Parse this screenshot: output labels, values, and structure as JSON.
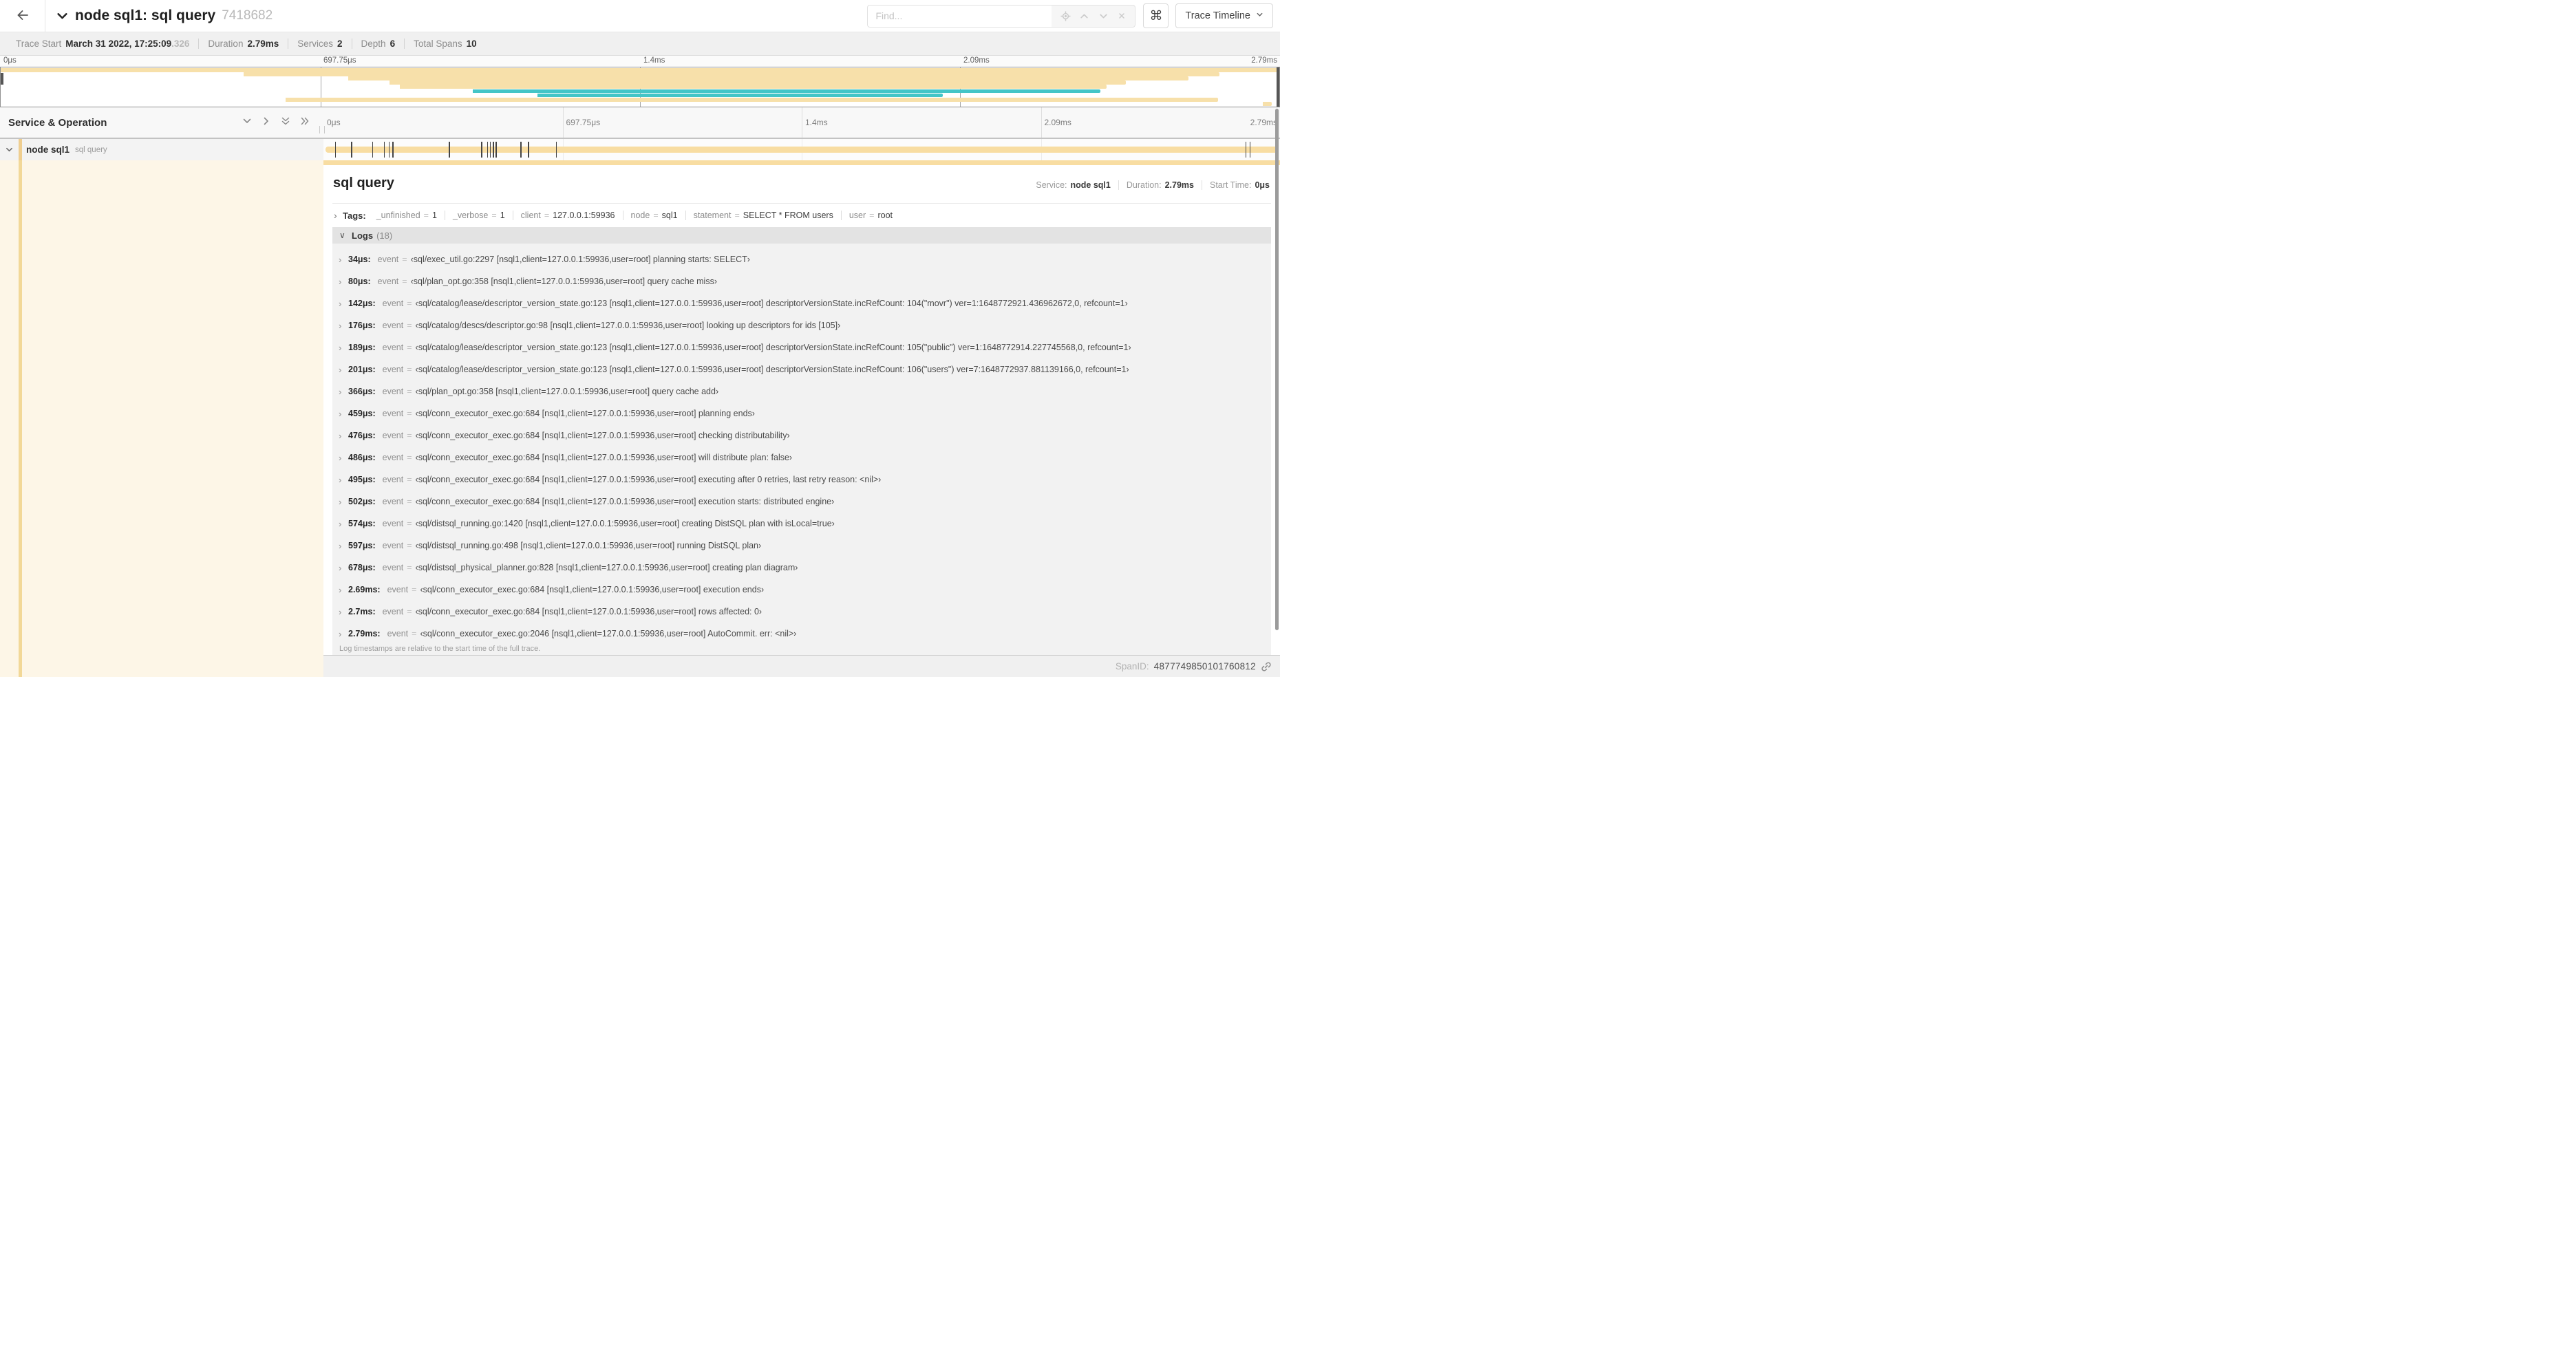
{
  "header": {
    "title": "node sql1: sql query",
    "trace_id": "7418682",
    "find_placeholder": "Find...",
    "view_label": "Trace Timeline"
  },
  "stats": [
    {
      "label": "Trace Start",
      "value": "March 31 2022, 17:25:09",
      "suffix": ".326"
    },
    {
      "label": "Duration",
      "value": "2.79ms"
    },
    {
      "label": "Services",
      "value": "2"
    },
    {
      "label": "Depth",
      "value": "6"
    },
    {
      "label": "Total Spans",
      "value": "10"
    }
  ],
  "ruler_labels": [
    "0μs",
    "697.75μs",
    "1.4ms",
    "2.09ms",
    "2.79ms"
  ],
  "minimap": {
    "colors": {
      "tan": "#f7e0aa",
      "teal": "#44c5c7"
    },
    "rows": [
      {
        "s": 0,
        "e": 100,
        "c": "tan"
      },
      {
        "s": 19,
        "e": 95.3,
        "c": "tan"
      },
      {
        "s": 27.2,
        "e": 92.9,
        "c": "tan"
      },
      {
        "s": 30.4,
        "e": 88,
        "c": "tan"
      },
      {
        "s": 31.2,
        "e": 86.5,
        "c": "tan"
      },
      {
        "s": 36.9,
        "e": 86,
        "c": "teal"
      },
      {
        "s": 42,
        "e": 73.7,
        "c": "teal"
      },
      {
        "s": 22.3,
        "e": 95.2,
        "c": "tan"
      },
      {
        "s": 98.7,
        "e": 99.4,
        "c": "tan"
      }
    ]
  },
  "left_header": "Service & Operation",
  "span_row": {
    "service": "node sql1",
    "operation": "sql query"
  },
  "detail": {
    "title": "sql query",
    "service_label": "Service:",
    "service": "node sql1",
    "duration_label": "Duration:",
    "duration": "2.79ms",
    "start_label": "Start Time:",
    "start": "0μs",
    "tags_label": "Tags:",
    "tags": [
      {
        "k": "_unfinished",
        "v": "1"
      },
      {
        "k": "_verbose",
        "v": "1"
      },
      {
        "k": "client",
        "v": "127.0.0.1:59936"
      },
      {
        "k": "node",
        "v": "sql1"
      },
      {
        "k": "statement",
        "v": "SELECT * FROM users"
      },
      {
        "k": "user",
        "v": "root"
      }
    ],
    "logs_label": "Logs",
    "logs_count": "(18)",
    "logs": [
      {
        "t": "34μs:",
        "k": "event",
        "pct": 1.2,
        "v": "‹sql/exec_util.go:2297 [nsql1,client=127.0.0.1:59936,user=root] planning starts: SELECT›"
      },
      {
        "t": "80μs:",
        "k": "event",
        "pct": 2.9,
        "v": "‹sql/plan_opt.go:358 [nsql1,client=127.0.0.1:59936,user=root] query cache miss›"
      },
      {
        "t": "142μs:",
        "k": "event",
        "pct": 5.1,
        "v": "‹sql/catalog/lease/descriptor_version_state.go:123 [nsql1,client=127.0.0.1:59936,user=root] descriptorVersionState.incRefCount: 104(\"movr\") ver=1:1648772921.436962672,0, refcount=1›"
      },
      {
        "t": "176μs:",
        "k": "event",
        "pct": 6.3,
        "v": "‹sql/catalog/descs/descriptor.go:98 [nsql1,client=127.0.0.1:59936,user=root] looking up descriptors for ids [105]›"
      },
      {
        "t": "189μs:",
        "k": "event",
        "pct": 6.8,
        "v": "‹sql/catalog/lease/descriptor_version_state.go:123 [nsql1,client=127.0.0.1:59936,user=root] descriptorVersionState.incRefCount: 105(\"public\") ver=1:1648772914.227745568,0, refcount=1›"
      },
      {
        "t": "201μs:",
        "k": "event",
        "pct": 7.2,
        "v": "‹sql/catalog/lease/descriptor_version_state.go:123 [nsql1,client=127.0.0.1:59936,user=root] descriptorVersionState.incRefCount: 106(\"users\") ver=7:1648772937.881139166,0, refcount=1›"
      },
      {
        "t": "366μs:",
        "k": "event",
        "pct": 13.1,
        "v": "‹sql/plan_opt.go:358 [nsql1,client=127.0.0.1:59936,user=root] query cache add›"
      },
      {
        "t": "459μs:",
        "k": "event",
        "pct": 16.5,
        "v": "‹sql/conn_executor_exec.go:684 [nsql1,client=127.0.0.1:59936,user=root] planning ends›"
      },
      {
        "t": "476μs:",
        "k": "event",
        "pct": 17.1,
        "v": "‹sql/conn_executor_exec.go:684 [nsql1,client=127.0.0.1:59936,user=root] checking distributability›"
      },
      {
        "t": "486μs:",
        "k": "event",
        "pct": 17.4,
        "v": "‹sql/conn_executor_exec.go:684 [nsql1,client=127.0.0.1:59936,user=root] will distribute plan: false›"
      },
      {
        "t": "495μs:",
        "k": "event",
        "pct": 17.7,
        "v": "‹sql/conn_executor_exec.go:684 [nsql1,client=127.0.0.1:59936,user=root] executing after 0 retries, last retry reason: <nil>›"
      },
      {
        "t": "502μs:",
        "k": "event",
        "pct": 18.0,
        "v": "‹sql/conn_executor_exec.go:684 [nsql1,client=127.0.0.1:59936,user=root] execution starts: distributed engine›"
      },
      {
        "t": "574μs:",
        "k": "event",
        "pct": 20.6,
        "v": "‹sql/distsql_running.go:1420 [nsql1,client=127.0.0.1:59936,user=root] creating DistSQL plan with isLocal=true›"
      },
      {
        "t": "597μs:",
        "k": "event",
        "pct": 21.4,
        "v": "‹sql/distsql_running.go:498 [nsql1,client=127.0.0.1:59936,user=root] running DistSQL plan›"
      },
      {
        "t": "678μs:",
        "k": "event",
        "pct": 24.3,
        "v": "‹sql/distsql_physical_planner.go:828 [nsql1,client=127.0.0.1:59936,user=root] creating plan diagram›"
      },
      {
        "t": "2.69ms:",
        "k": "event",
        "pct": 96.4,
        "v": "‹sql/conn_executor_exec.go:684 [nsql1,client=127.0.0.1:59936,user=root] execution ends›"
      },
      {
        "t": "2.7ms:",
        "k": "event",
        "pct": 96.8,
        "v": "‹sql/conn_executor_exec.go:684 [nsql1,client=127.0.0.1:59936,user=root] rows affected: 0›"
      },
      {
        "t": "2.79ms:",
        "k": "event",
        "pct": 100,
        "v": "‹sql/conn_executor_exec.go:2046 [nsql1,client=127.0.0.1:59936,user=root] AutoCommit. err: <nil>›"
      }
    ],
    "footer": "Log timestamps are relative to the start time of the full trace.",
    "spanid_label": "SpanID:",
    "spanid": "4877749850101760812"
  }
}
